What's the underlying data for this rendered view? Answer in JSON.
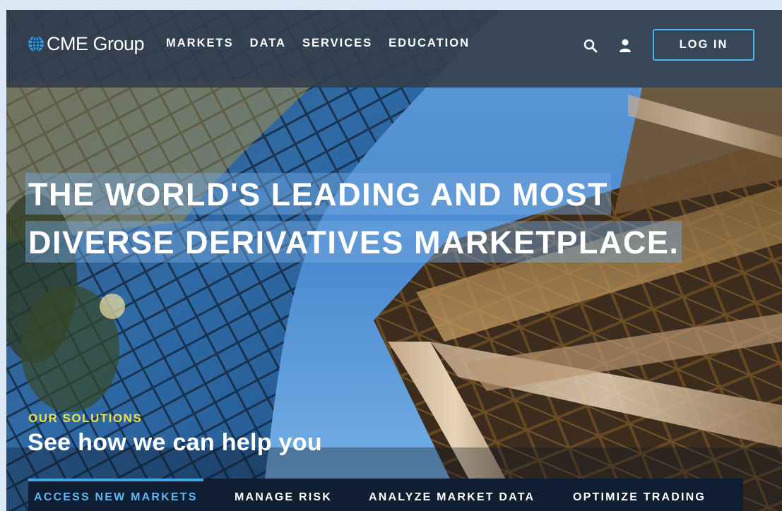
{
  "header": {
    "logo_text": "CME Group",
    "nav": [
      {
        "label": "MARKETS"
      },
      {
        "label": "DATA"
      },
      {
        "label": "SERVICES"
      },
      {
        "label": "EDUCATION"
      }
    ],
    "search_icon": "search-icon",
    "user_icon": "user-icon",
    "login_label": "LOG IN"
  },
  "hero": {
    "headline_line1": "THE WORLD'S LEADING AND MOST",
    "headline_line2": "DIVERSE DERIVATIVES MARKETPLACE."
  },
  "solutions": {
    "eyebrow": "OUR SOLUTIONS",
    "title": "See how we can help you",
    "tabs": [
      {
        "label": "ACCESS NEW MARKETS",
        "active": true
      },
      {
        "label": "MANAGE RISK",
        "active": false
      },
      {
        "label": "ANALYZE MARKET DATA",
        "active": false
      },
      {
        "label": "OPTIMIZE TRADING",
        "active": false
      }
    ]
  },
  "colors": {
    "accent_blue": "#4fb7ec",
    "eyebrow_yellow": "#f0e040",
    "tab_bar": "#0f1e32",
    "header_bg": "#343e4a"
  }
}
